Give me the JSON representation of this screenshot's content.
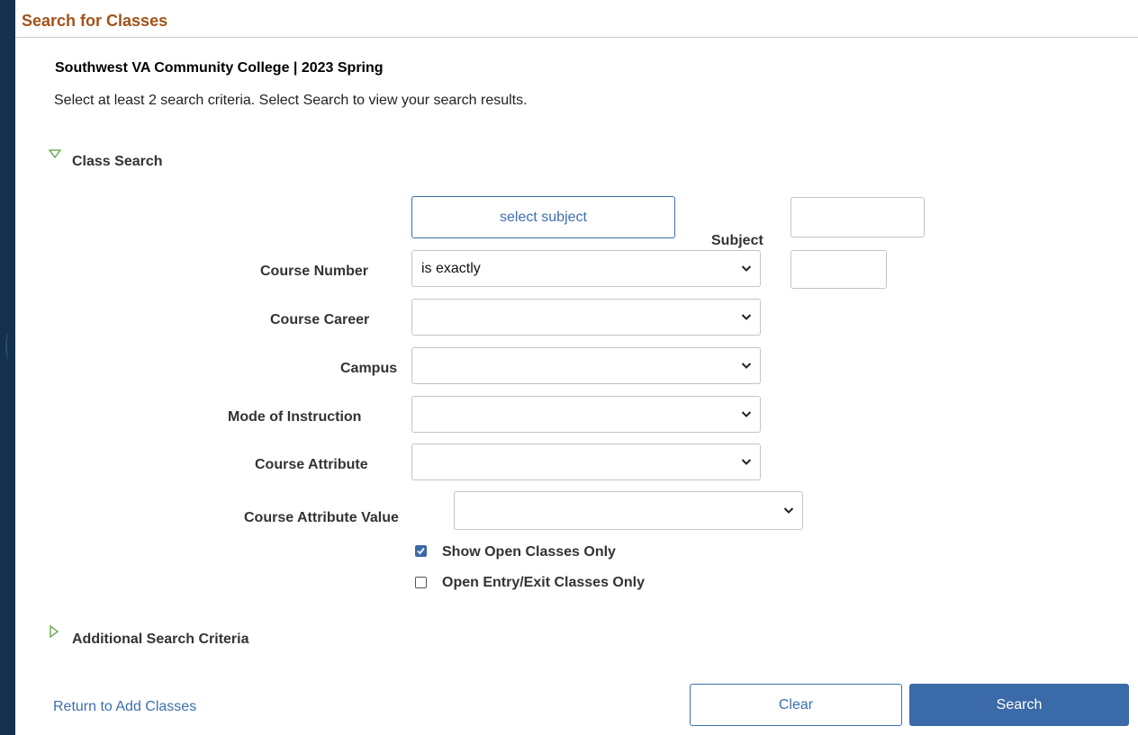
{
  "header": {
    "title": "Search for Classes"
  },
  "institution": "Southwest VA Community College | 2023 Spring",
  "instructions": "Select at least 2 search criteria. Select Search to view your search results.",
  "class_search": {
    "toggle_label": "Class Search",
    "expanded": true,
    "subject": {
      "button_label": "select subject",
      "label": "Subject",
      "value": ""
    },
    "course_number": {
      "label": "Course Number",
      "operator": "is exactly",
      "value": ""
    },
    "course_career": {
      "label": "Course Career",
      "value": ""
    },
    "campus": {
      "label": "Campus",
      "value": ""
    },
    "mode_of_instruction": {
      "label": "Mode of Instruction",
      "value": ""
    },
    "course_attribute": {
      "label": "Course Attribute",
      "value": ""
    },
    "course_attribute_value": {
      "label": "Course Attribute Value",
      "value": ""
    },
    "show_open_classes": {
      "label": "Show Open Classes Only",
      "checked": true
    },
    "open_entry_exit": {
      "label": "Open Entry/Exit Classes Only",
      "checked": false
    }
  },
  "additional_criteria": {
    "toggle_label": "Additional Search Criteria",
    "expanded": false
  },
  "footer": {
    "return_link": "Return to Add Classes",
    "clear_label": "Clear",
    "search_label": "Search"
  },
  "colors": {
    "background": "#13304f",
    "title": "#a3521a",
    "primary": "#3b6aa8",
    "link": "#3d6fae",
    "expanded_arrow": "#6fae5b"
  }
}
